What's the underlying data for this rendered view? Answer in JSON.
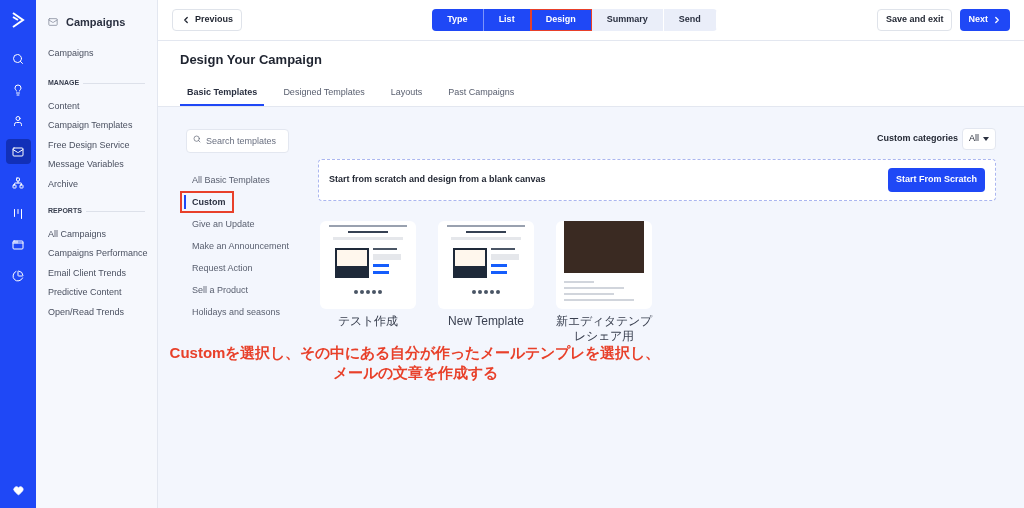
{
  "rail": {
    "items": [
      {
        "selected": false
      },
      {
        "selected": false
      },
      {
        "selected": false
      },
      {
        "selected": true
      },
      {
        "selected": false
      },
      {
        "selected": false
      },
      {
        "selected": false
      },
      {
        "selected": false
      }
    ]
  },
  "sidebar": {
    "title": "Campaigns",
    "top_item": "Campaigns",
    "sections": [
      {
        "heading": "MANAGE",
        "items": [
          "Content",
          "Campaign Templates",
          "Free Design Service",
          "Message Variables",
          "Archive"
        ]
      },
      {
        "heading": "REPORTS",
        "items": [
          "All Campaigns",
          "Campaigns Performance",
          "Email Client Trends",
          "Predictive Content",
          "Open/Read Trends"
        ]
      }
    ]
  },
  "topbar": {
    "previous": "Previous",
    "steps": [
      {
        "label": "Type",
        "reached": true,
        "highlighted": false
      },
      {
        "label": "List",
        "reached": true,
        "highlighted": false
      },
      {
        "label": "Design",
        "reached": true,
        "highlighted": true
      },
      {
        "label": "Summary",
        "reached": false,
        "highlighted": false
      },
      {
        "label": "Send",
        "reached": false,
        "highlighted": false
      }
    ],
    "save": "Save and exit",
    "next": "Next"
  },
  "page": {
    "title": "Design Your Campaign",
    "tabs": [
      {
        "label": "Basic Templates",
        "selected": true
      },
      {
        "label": "Designed Templates",
        "selected": false
      },
      {
        "label": "Layouts",
        "selected": false
      },
      {
        "label": "Past Campaigns",
        "selected": false
      }
    ]
  },
  "search": {
    "placeholder": "Search templates"
  },
  "categories": [
    {
      "label": "All Basic Templates",
      "selected": false,
      "highlighted": false
    },
    {
      "label": "Custom",
      "selected": true,
      "highlighted": true
    },
    {
      "label": "Give an Update",
      "selected": false,
      "highlighted": false
    },
    {
      "label": "Make an Announcement",
      "selected": false,
      "highlighted": false
    },
    {
      "label": "Request Action",
      "selected": false,
      "highlighted": false
    },
    {
      "label": "Sell a Product",
      "selected": false,
      "highlighted": false
    },
    {
      "label": "Holidays and seasons",
      "selected": false,
      "highlighted": false
    }
  ],
  "filter": {
    "label": "Custom categories",
    "value": "All"
  },
  "scratch": {
    "text": "Start from scratch and design from a blank canvas",
    "button": "Start From Scratch"
  },
  "templates": [
    {
      "kind": "layout",
      "name": "テスト作成"
    },
    {
      "kind": "layout",
      "name": "New Template"
    },
    {
      "kind": "photo",
      "name": "新エディタテンプレシェア用"
    }
  ],
  "annotation": [
    "Customを選択し、その中にある自分が作ったメールテンプレを選択し、",
    "メールの文章を作成する"
  ]
}
